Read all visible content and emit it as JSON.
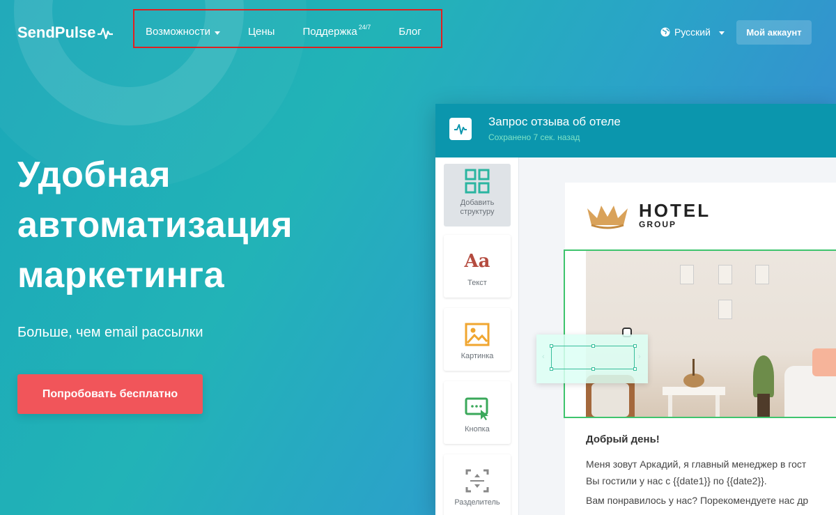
{
  "header": {
    "logo_text": "SendPulse",
    "nav": [
      {
        "label": "Возможности",
        "has_caret": true
      },
      {
        "label": "Цены"
      },
      {
        "label": "Поддержка",
        "sup": "24/7"
      },
      {
        "label": "Блог"
      }
    ],
    "language": "Русский",
    "account_button": "Мой аккаунт"
  },
  "hero": {
    "title_lines": [
      "Удобная",
      "автоматизация",
      "маркетинга"
    ],
    "subtitle": "Больше, чем email рассылки",
    "cta": "Попробовать бесплатно"
  },
  "editor": {
    "title": "Запрос отзыва об отеле",
    "saved_status": "Сохранено 7 сек. назад",
    "blocks": [
      {
        "label": "Добавить структуру",
        "icon": "grid-icon"
      },
      {
        "label": "Текст",
        "icon": "text-aa-icon",
        "glyph": "Aa"
      },
      {
        "label": "Картинка",
        "icon": "image-icon"
      },
      {
        "label": "Кнопка",
        "icon": "button-cursor-icon"
      },
      {
        "label": "Разделитель",
        "icon": "divider-icon"
      }
    ],
    "email": {
      "brand_name": "HOTEL",
      "brand_sub": "GROUP",
      "greeting": "Добрый день!",
      "body_line1": "Меня зовут Аркадий, я главный менеджер в гост",
      "body_line2": "Вы гостили у нас с {{date1}} по {{date2}}.",
      "body_line3": "Вам понравилось у нас? Порекомендуете нас др"
    }
  },
  "colors": {
    "cta": "#f1555a",
    "editor_header": "#0b96ad",
    "selection": "#3ec46d",
    "highlight_box": "#e02020"
  }
}
